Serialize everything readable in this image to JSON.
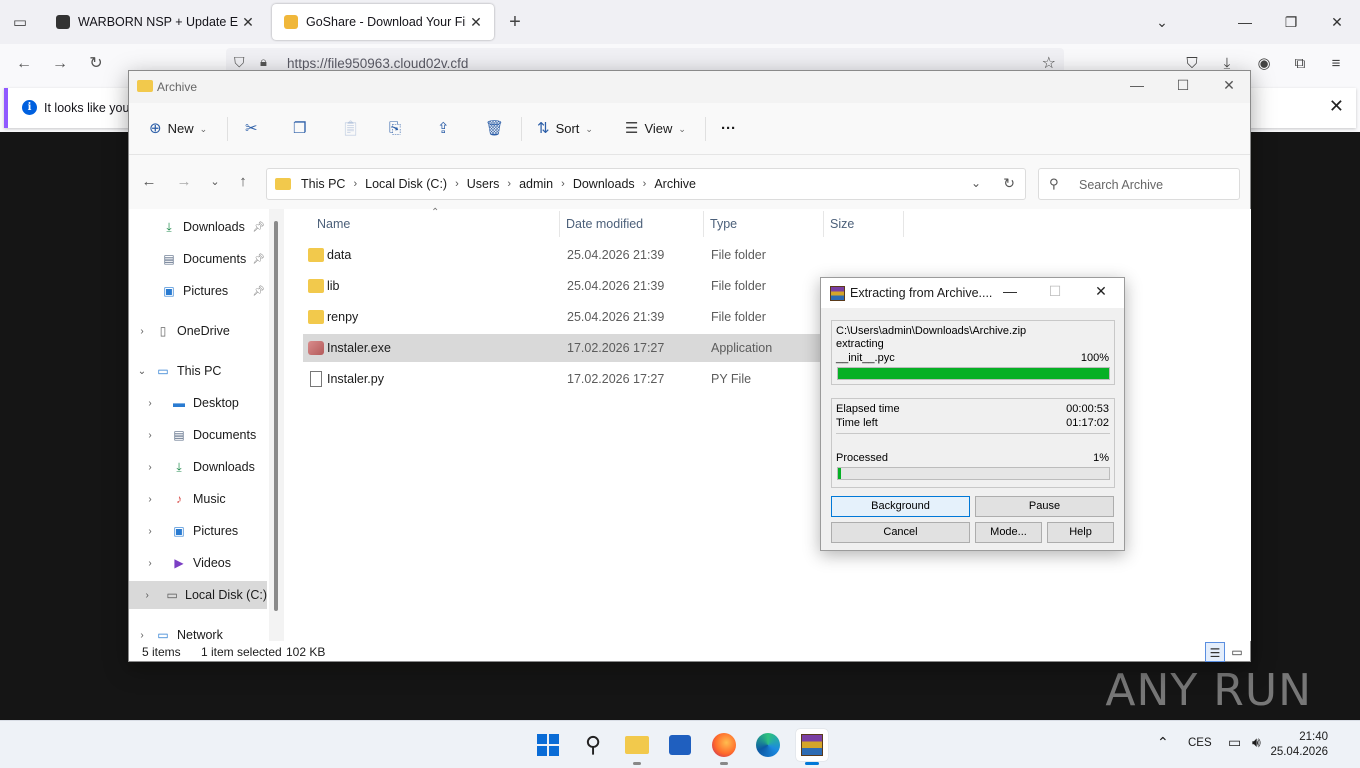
{
  "browser": {
    "tabs": [
      {
        "title": "WARBORN NSP + Update Epic N",
        "close": "✕"
      },
      {
        "title": "GoShare - Download Your File",
        "close": "✕"
      }
    ],
    "new_tab": "+",
    "url": "https://file950963.cloud02v.cfd",
    "notice_text": "It looks like you h",
    "window_controls": {
      "list": "⌄",
      "minimize": "—",
      "maximize": "❐",
      "close": "✕"
    }
  },
  "explorer": {
    "title": "Archive",
    "toolbar": {
      "new": "New",
      "sort": "Sort",
      "view": "View",
      "more": "···"
    },
    "breadcrumb": [
      "This PC",
      "Local Disk (C:)",
      "Users",
      "admin",
      "Downloads",
      "Archive"
    ],
    "search_placeholder": "Search Archive",
    "nav": {
      "quick": [
        {
          "label": "Downloads",
          "icon": "download-icon"
        },
        {
          "label": "Documents",
          "icon": "documents-icon"
        },
        {
          "label": "Pictures",
          "icon": "pictures-icon"
        }
      ],
      "onedrive": "OneDrive",
      "thispc": "This PC",
      "pc_items": [
        {
          "label": "Desktop"
        },
        {
          "label": "Documents"
        },
        {
          "label": "Downloads"
        },
        {
          "label": "Music"
        },
        {
          "label": "Pictures"
        },
        {
          "label": "Videos"
        },
        {
          "label": "Local Disk (C:)"
        }
      ],
      "network": "Network"
    },
    "columns": {
      "name": "Name",
      "date": "Date modified",
      "type": "Type",
      "size": "Size"
    },
    "files": [
      {
        "name": "data",
        "date": "25.04.2026 21:39",
        "type": "File folder",
        "kind": "folder"
      },
      {
        "name": "lib",
        "date": "25.04.2026 21:39",
        "type": "File folder",
        "kind": "folder"
      },
      {
        "name": "renpy",
        "date": "25.04.2026 21:39",
        "type": "File folder",
        "kind": "folder"
      },
      {
        "name": "Instaler.exe",
        "date": "17.02.2026 17:27",
        "type": "Application",
        "kind": "exe"
      },
      {
        "name": "Instaler.py",
        "date": "17.02.2026 17:27",
        "type": "PY File",
        "kind": "py"
      }
    ],
    "status": {
      "items": "5 items",
      "selected": "1 item selected",
      "size": "102 KB"
    }
  },
  "rar": {
    "title": "Extracting from Archive....",
    "archive_path": "C:\\Users\\admin\\Downloads\\Archive.zip",
    "action": "extracting",
    "current_file": "__init__.pyc",
    "file_percent": "100%",
    "file_progress": 1.0,
    "elapsed_label": "Elapsed time",
    "elapsed": "00:00:53",
    "left_label": "Time left",
    "left": "01:17:02",
    "processed_label": "Processed",
    "processed_percent": "1%",
    "processed_progress": 0.01,
    "buttons": {
      "background": "Background",
      "pause": "Pause",
      "cancel": "Cancel",
      "mode": "Mode...",
      "help": "Help"
    }
  },
  "watermark": "ANY RUN",
  "taskbar": {
    "language": "CES",
    "time": "21:40",
    "date": "25.04.2026"
  },
  "colors": {
    "progress": "#06b025",
    "accent": "#0078d7",
    "folder": "#f2c94c"
  }
}
